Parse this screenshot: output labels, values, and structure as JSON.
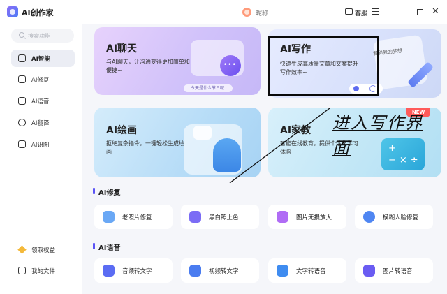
{
  "app": {
    "title": "AI创作家",
    "nickname": "昵称",
    "service_label": "客服"
  },
  "sidebar": {
    "search_placeholder": "搜索功能",
    "items": [
      {
        "label": "AI智能",
        "icon": "ai-chip-icon",
        "active": true
      },
      {
        "label": "AI修复",
        "icon": "edit-icon"
      },
      {
        "label": "AI语音",
        "icon": "audio-icon"
      },
      {
        "label": "AI翻译",
        "icon": "translate-icon"
      },
      {
        "label": "AI识图",
        "icon": "image-icon"
      }
    ],
    "bottom": [
      {
        "label": "领取权益",
        "icon": "gift-icon"
      },
      {
        "label": "我的文件",
        "icon": "file-icon"
      }
    ]
  },
  "cards": {
    "chat": {
      "title": "AI聊天",
      "desc": "与AI聊天，让沟通变得更加简单和便捷~",
      "tip": "今天是什么节日呢"
    },
    "write": {
      "title": "AI写作",
      "desc": "快速生成高质量文章和文案提升写作效率~",
      "tip": "我和我的梦想"
    },
    "paint": {
      "title": "AI绘画",
      "desc": "拒绝复杂指令，一键轻松生成绘画"
    },
    "edu": {
      "title": "AI家教",
      "desc": "智能在线教育，提供个性化学习体验",
      "badge": "NEW",
      "symbols": "+−×÷"
    }
  },
  "sections": {
    "repair": {
      "title": "AI修复",
      "tools": [
        {
          "label": "老照片修复",
          "color": "#6aa8f5"
        },
        {
          "label": "黑白照上色",
          "color": "#7b6cf5"
        },
        {
          "label": "图片无损放大",
          "color": "#b06cf5"
        },
        {
          "label": "模糊人脸修复",
          "color": "#4f86f2"
        }
      ]
    },
    "voice": {
      "title": "AI语音",
      "tools": [
        {
          "label": "音频转文字",
          "color": "#5b6cf3"
        },
        {
          "label": "视频转文字",
          "color": "#4a7cf0"
        },
        {
          "label": "文字转语音",
          "color": "#3f8cf0"
        },
        {
          "label": "图片转语音",
          "color": "#6a5cf2"
        }
      ]
    }
  },
  "annotation": {
    "text": "进入写作界面"
  },
  "colors": {
    "accent": "#5b54f6",
    "new_badge": "#ff5a5a",
    "sidebar_active": "#ebedf4"
  }
}
